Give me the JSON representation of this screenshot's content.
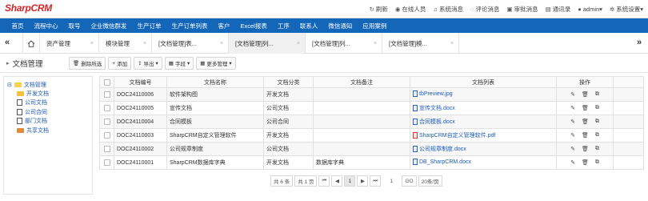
{
  "app": {
    "logo": "SharpCRM"
  },
  "topbar": {
    "items": [
      {
        "icon": "refresh-icon",
        "glyph": "↻",
        "label": "刷新"
      },
      {
        "icon": "online-users-icon",
        "glyph": "◉",
        "label": "在线人员"
      },
      {
        "icon": "system-message-icon",
        "glyph": "♫",
        "label": "系统消息"
      },
      {
        "icon": "comment-message-icon",
        "glyph": "◌",
        "label": "评论消息"
      },
      {
        "icon": "approval-message-icon",
        "glyph": "▣",
        "label": "审批消息"
      },
      {
        "icon": "address-book-icon",
        "glyph": "▤",
        "label": "通讯录"
      },
      {
        "icon": "user-icon",
        "glyph": "●",
        "label": "admin▾"
      },
      {
        "icon": "settings-icon",
        "glyph": "✲",
        "label": "系统设置▾"
      }
    ]
  },
  "nav": {
    "items": [
      "首页",
      "流程中心",
      "取号",
      "企业微信群发",
      "生产订单",
      "生产订单列表",
      "客户",
      "Excel报表",
      "工序",
      "联系人",
      "微信通知",
      "应用案例"
    ]
  },
  "tabs": {
    "prev": "«",
    "next": "»",
    "items": [
      {
        "label": "资产管理",
        "active": false
      },
      {
        "label": "模块管理",
        "active": false
      },
      {
        "label": "[文档管理]表...",
        "active": false
      },
      {
        "label": "[文档管理]列...",
        "active": true
      },
      {
        "label": "[文档管理]列...",
        "active": false
      },
      {
        "label": "[文档管理]模...",
        "active": false
      }
    ],
    "close": "×"
  },
  "page": {
    "title": "文档管理",
    "toolbar": {
      "delete": "删除所选",
      "add": "添加",
      "export": "导出",
      "fields": "字段",
      "more": "更多管理"
    }
  },
  "tree": {
    "root": "文档管理",
    "children": [
      "开发文档",
      "公司文档",
      "公司合同",
      "部门文档",
      "共享文档"
    ]
  },
  "table": {
    "columns": [
      "文档编号",
      "文档名称",
      "文档分类",
      "文档备注",
      "文档列表",
      "操作"
    ],
    "rows": [
      {
        "id": "DOC24110006",
        "name": "软件架构图",
        "category": "开发文档",
        "remark": "",
        "file": "tbPreview.jpg",
        "pdf": false
      },
      {
        "id": "DOC24110005",
        "name": "宣传文档",
        "category": "公司文档",
        "remark": "",
        "file": "宣传文档.docx",
        "pdf": false
      },
      {
        "id": "DOC24110004",
        "name": "合同模板",
        "category": "公司合同",
        "remark": "",
        "file": "合同模板.docx",
        "pdf": false
      },
      {
        "id": "DOC24110003",
        "name": "SharpCRM自定义管理软件",
        "category": "开发文档",
        "remark": "",
        "file": "SharpCRM自定义管理软件.pdf",
        "pdf": true
      },
      {
        "id": "DOC24110002",
        "name": "公司规章制度",
        "category": "公司文档",
        "remark": "",
        "file": "公司规章制度.docx",
        "pdf": false
      },
      {
        "id": "DOC24110001",
        "name": "SharpCRM数据库字典",
        "category": "开发文档",
        "remark": "数据库字典",
        "file": "DB_SharpCRM.docx",
        "pdf": false
      }
    ]
  },
  "pager": {
    "total": "共 6 条",
    "pages": "共 1 页",
    "first": "⏮",
    "prev": "◀",
    "current": "1",
    "next": "▶",
    "last": "⏭",
    "goto_value": "1",
    "go": "GO",
    "page_size": "20条/页"
  }
}
